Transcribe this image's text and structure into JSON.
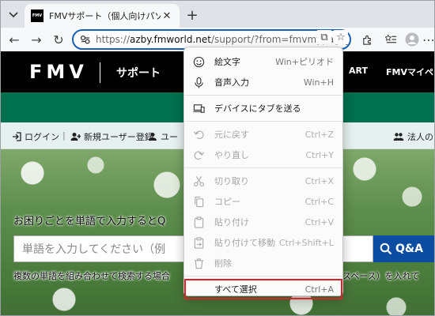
{
  "tab": {
    "favicon_text": "FMV",
    "title": "FMVサポート（個人向けパソコンFMV..."
  },
  "address": {
    "host": "azby.fmworld.net",
    "prefix": "https://",
    "path": "/support/?from=fmvmypage_ho"
  },
  "header": {
    "logo": "FMV",
    "support": "サポート",
    "nav_cart": "ART",
    "nav_mypage": "FMVマイペー"
  },
  "login_bar": {
    "login": "ログイン",
    "register": "新規ユーザー登録",
    "user": "ユー",
    "corporate": "法人のお"
  },
  "hero": {
    "question": "お困りごとを単語で入力するとQ",
    "search_placeholder": "単語を入力してください（例",
    "search_button": "Q&A",
    "hint": "複数の単語を組み合わせて検索する場合",
    "hint_right": "スペース）を入れて"
  },
  "context_menu": {
    "items": [
      {
        "icon": "emoji-icon",
        "label": "絵文字",
        "shortcut": "Win+ピリオド",
        "enabled": true
      },
      {
        "icon": "microphone-icon",
        "label": "音声入力",
        "shortcut": "Win+H",
        "enabled": true
      },
      {
        "icon": "send-to-device-icon",
        "label": "デバイスにタブを送る",
        "shortcut": "",
        "enabled": true
      },
      {
        "icon": "undo-icon",
        "label": "元に戻す",
        "shortcut": "Ctrl+Z",
        "enabled": false
      },
      {
        "icon": "redo-icon",
        "label": "やり直し",
        "shortcut": "Ctrl+Y",
        "enabled": false
      },
      {
        "icon": "cut-icon",
        "label": "切り取り",
        "shortcut": "Ctrl+X",
        "enabled": false
      },
      {
        "icon": "copy-icon",
        "label": "コピー",
        "shortcut": "Ctrl+C",
        "enabled": false
      },
      {
        "icon": "paste-icon",
        "label": "貼り付け",
        "shortcut": "Ctrl+V",
        "enabled": false
      },
      {
        "icon": "paste-and-move-icon",
        "label": "貼り付けて移動",
        "shortcut": "Ctrl+Shift+L",
        "enabled": false
      },
      {
        "icon": "delete-icon",
        "label": "削除",
        "shortcut": "",
        "enabled": false
      },
      {
        "icon": "",
        "label": "すべて選択",
        "shortcut": "Ctrl+A",
        "enabled": true,
        "highlighted": true
      }
    ]
  },
  "colors": {
    "accent_blue": "#1a5fb4",
    "fmv_green": "#00704f",
    "search_blue": "#0c4da2",
    "highlight_red": "#d9222a"
  }
}
